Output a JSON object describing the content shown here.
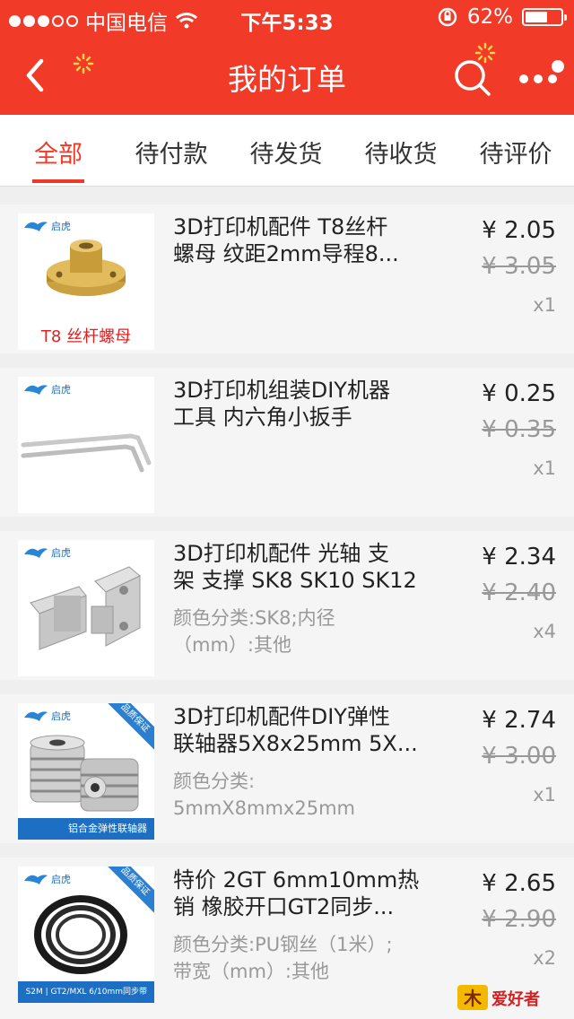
{
  "status_bar": {
    "carrier": "中国电信",
    "time": "下午5:33",
    "battery": "62%",
    "battery_level": 0.62
  },
  "nav": {
    "title": "我的订单"
  },
  "tabs": [
    {
      "label": "全部",
      "active": true
    },
    {
      "label": "待付款",
      "active": false
    },
    {
      "label": "待发货",
      "active": false
    },
    {
      "label": "待收货",
      "active": false
    },
    {
      "label": "待评价",
      "active": false
    }
  ],
  "orders": [
    {
      "name_line1": "3D打印机配件 T8丝杆",
      "name_line2": "螺母 纹距2mm导程8...",
      "sku_line1": "",
      "sku_line2": "",
      "price": "¥ 2.05",
      "original_price": "¥ 3.05",
      "quantity": "x1",
      "thumb_brand": "启虎",
      "thumb_caption": "T8 丝杆螺母"
    },
    {
      "name_line1": "3D打印机组装DIY机器",
      "name_line2": "工具  内六角小扳手",
      "sku_line1": "",
      "sku_line2": "",
      "price": "¥ 0.25",
      "original_price": "¥ 0.35",
      "quantity": "x1",
      "thumb_brand": "启虎"
    },
    {
      "name_line1": "3D打印机配件 光轴 支",
      "name_line2": "架 支撑 SK8 SK10 SK12",
      "sku_line1": "颜色分类:SK8;内径",
      "sku_line2": "（mm）:其他",
      "price": "¥ 2.34",
      "original_price": "¥ 2.40",
      "quantity": "x4",
      "thumb_brand": "启虎"
    },
    {
      "name_line1": "3D打印机配件DIY弹性",
      "name_line2": "联轴器5X8x25mm 5X...",
      "sku_line1": "颜色分类:",
      "sku_line2": "5mmX8mmx25mm",
      "price": "¥ 2.74",
      "original_price": "¥ 3.00",
      "quantity": "x1",
      "thumb_brand": "启虎",
      "thumb_ribbon": "品质保证",
      "thumb_banner": "铝合金弹性联轴器"
    },
    {
      "name_line1": "特价 2GT 6mm10mm热",
      "name_line2": "销 橡胶开口GT2同步...",
      "sku_line1": "颜色分类:PU钢丝（1米）;",
      "sku_line2": "带宽（mm）:其他",
      "price": "¥ 2.65",
      "original_price": "¥ 2.90",
      "quantity": "x2",
      "thumb_brand": "启虎",
      "thumb_ribbon": "品质保证",
      "thumb_banner": "S2M | GT2/MXL 6/10mm同步带"
    }
  ],
  "watermark": {
    "text": "爱好者"
  },
  "colors": {
    "brand_red": "#f23a28",
    "tab_active": "#f03a28"
  }
}
